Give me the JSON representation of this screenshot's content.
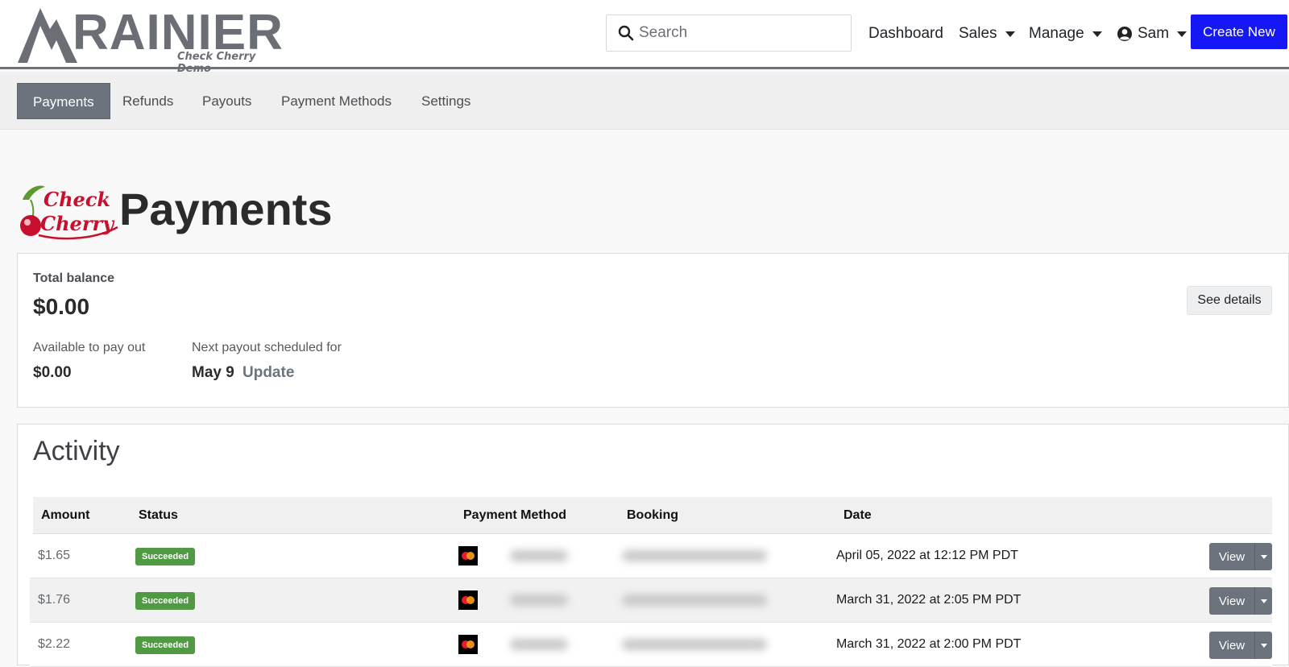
{
  "brand": {
    "name": "RAINIER",
    "subtitle": "Check Cherry Demo"
  },
  "search": {
    "placeholder": "Search",
    "value": ""
  },
  "nav": {
    "dashboard": "Dashboard",
    "sales": "Sales",
    "manage": "Manage",
    "user": "Sam",
    "create_new": "Create New"
  },
  "colors": {
    "primary": "#1518f5",
    "secondary": "#6c737d",
    "success": "#4f9a43"
  },
  "subnav": {
    "tabs": [
      {
        "label": "Payments",
        "active": true
      },
      {
        "label": "Refunds",
        "active": false
      },
      {
        "label": "Payouts",
        "active": false
      },
      {
        "label": "Payment Methods",
        "active": false
      },
      {
        "label": "Settings",
        "active": false
      }
    ]
  },
  "page": {
    "logo_text": "Check Cherry",
    "title": "Payments"
  },
  "balance": {
    "total_label": "Total balance",
    "total_value": "$0.00",
    "available_label": "Available to pay out",
    "available_value": "$0.00",
    "next_payout_label": "Next payout scheduled for",
    "next_payout_date": "May 9",
    "update_label": "Update",
    "see_details_label": "See details"
  },
  "activity": {
    "title": "Activity",
    "columns": [
      "Amount",
      "Status",
      "Payment Method",
      "Booking",
      "Date"
    ],
    "rows": [
      {
        "amount": "$1.65",
        "status": "Succeeded",
        "date": "April 05, 2022 at 12:12 PM PDT",
        "view": "View",
        "card_icon": "mastercard-icon"
      },
      {
        "amount": "$1.76",
        "status": "Succeeded",
        "date": "March 31, 2022 at 2:05 PM PDT",
        "view": "View",
        "card_icon": "mastercard-icon"
      },
      {
        "amount": "$2.22",
        "status": "Succeeded",
        "date": "March 31, 2022 at 2:00 PM PDT",
        "view": "View",
        "card_icon": "mastercard-icon"
      }
    ]
  }
}
